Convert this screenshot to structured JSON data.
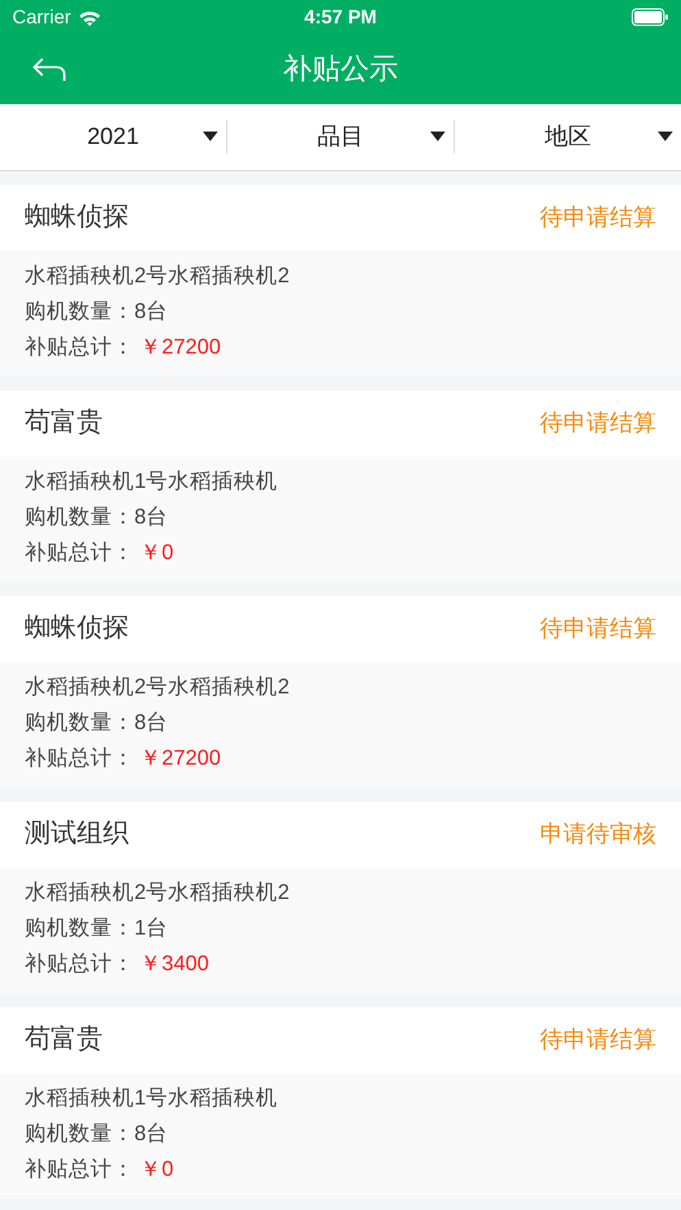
{
  "status_bar": {
    "carrier": "Carrier",
    "time": "4:57 PM"
  },
  "nav": {
    "title": "补贴公示"
  },
  "filters": [
    {
      "label": "2021"
    },
    {
      "label": "品目"
    },
    {
      "label": "地区"
    }
  ],
  "records": [
    {
      "name": "蜘蛛侦探",
      "status": "待申请结算",
      "machine": "水稻插秧机2号水稻插秧机2",
      "qty_label": "购机数量：",
      "qty": "8台",
      "total_label": "补贴总计：",
      "total": "￥27200"
    },
    {
      "name": "苟富贵",
      "status": "待申请结算",
      "machine": "水稻插秧机1号水稻插秧机",
      "qty_label": "购机数量：",
      "qty": "8台",
      "total_label": "补贴总计：",
      "total": "￥0"
    },
    {
      "name": "蜘蛛侦探",
      "status": "待申请结算",
      "machine": "水稻插秧机2号水稻插秧机2",
      "qty_label": "购机数量：",
      "qty": "8台",
      "total_label": "补贴总计：",
      "total": "￥27200"
    },
    {
      "name": "测试组织",
      "status": "申请待审核",
      "machine": "水稻插秧机2号水稻插秧机2",
      "qty_label": "购机数量：",
      "qty": "1台",
      "total_label": "补贴总计：",
      "total": "￥3400"
    },
    {
      "name": "苟富贵",
      "status": "待申请结算",
      "machine": "水稻插秧机1号水稻插秧机",
      "qty_label": "购机数量：",
      "qty": "8台",
      "total_label": "补贴总计：",
      "total": "￥0"
    }
  ]
}
